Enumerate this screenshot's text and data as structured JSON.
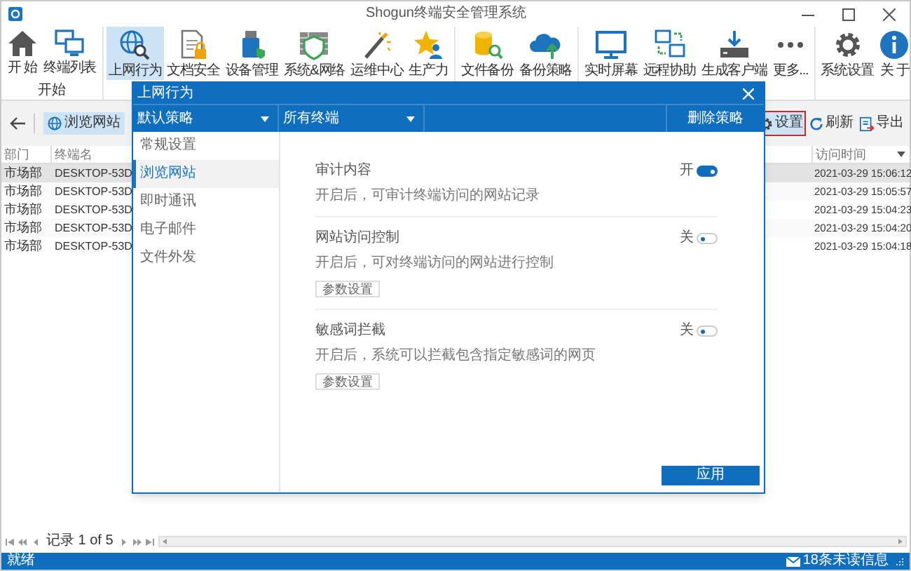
{
  "window": {
    "title": "Shogun终端安全管理系统"
  },
  "ribbon": {
    "groups": [
      {
        "label": "开始",
        "buttons": [
          {
            "label": "开 始",
            "selected": false
          },
          {
            "label": "终端列表",
            "selected": false
          }
        ]
      },
      {
        "buttons": [
          {
            "label": "上网行为",
            "selected": true
          },
          {
            "label": "文档安全",
            "selected": false
          },
          {
            "label": "设备管理",
            "selected": false
          },
          {
            "label": "系统&网络",
            "selected": false
          },
          {
            "label": "运维中心",
            "selected": false
          },
          {
            "label": "生产力",
            "selected": false
          }
        ]
      },
      {
        "buttons": [
          {
            "label": "文件备份",
            "selected": false
          },
          {
            "label": "备份策略",
            "selected": false
          }
        ]
      },
      {
        "buttons": [
          {
            "label": "实时屏幕",
            "selected": false
          },
          {
            "label": "远程协助",
            "selected": false
          },
          {
            "label": "生成客户端",
            "selected": false
          },
          {
            "label": "更多...",
            "selected": false
          }
        ]
      },
      {
        "buttons": [
          {
            "label": "系统设置",
            "selected": false
          },
          {
            "label": "关 于",
            "selected": false
          }
        ]
      }
    ]
  },
  "toolbar": {
    "tab_label": "浏览网站",
    "actions": [
      {
        "label": "设置",
        "highlighted": true
      },
      {
        "label": "刷新",
        "highlighted": false
      },
      {
        "label": "导出",
        "highlighted": false
      }
    ]
  },
  "table": {
    "columns": [
      "部门",
      "终端名",
      "访问时间"
    ],
    "rows": [
      {
        "department": "市场部",
        "terminal": "DESKTOP-53D",
        "time": "2021-03-29 15:06:12",
        "selected": true
      },
      {
        "department": "市场部",
        "terminal": "DESKTOP-53D",
        "time": "2021-03-29 15:05:57",
        "selected": false
      },
      {
        "department": "市场部",
        "terminal": "DESKTOP-53D",
        "time": "2021-03-29 15:04:23",
        "selected": false
      },
      {
        "department": "市场部",
        "terminal": "DESKTOP-53D",
        "time": "2021-03-29 15:04:20",
        "selected": false
      },
      {
        "department": "市场部",
        "terminal": "DESKTOP-53D",
        "time": "2021-03-29 15:04:18",
        "selected": false
      }
    ]
  },
  "pager": {
    "label": "记录 1 of 5"
  },
  "status_bar": {
    "text": "就绪",
    "messages": "18条未读信息"
  },
  "dialog": {
    "title": "上网行为",
    "policy": "默认策略",
    "scope": "所有终端",
    "delete_label": "删除策略",
    "menu": [
      {
        "label": "常规设置",
        "selected": false
      },
      {
        "label": "浏览网站",
        "selected": true
      },
      {
        "label": "即时通讯",
        "selected": false
      },
      {
        "label": "电子邮件",
        "selected": false
      },
      {
        "label": "文件外发",
        "selected": false
      }
    ],
    "sections": [
      {
        "title": "审计内容",
        "on": true,
        "switch_label": "开",
        "description": "开启后，可审计终端访问的网站记录"
      },
      {
        "title": "网站访问控制",
        "on": false,
        "switch_label": "关",
        "description": "开启后，可对终端访问的网站进行控制",
        "button": "参数设置"
      },
      {
        "title": "敏感词拦截",
        "on": false,
        "switch_label": "关",
        "description": "开启后，系统可以拦截包含指定敏感词的网页",
        "button": "参数设置"
      }
    ],
    "apply_label": "应用"
  }
}
